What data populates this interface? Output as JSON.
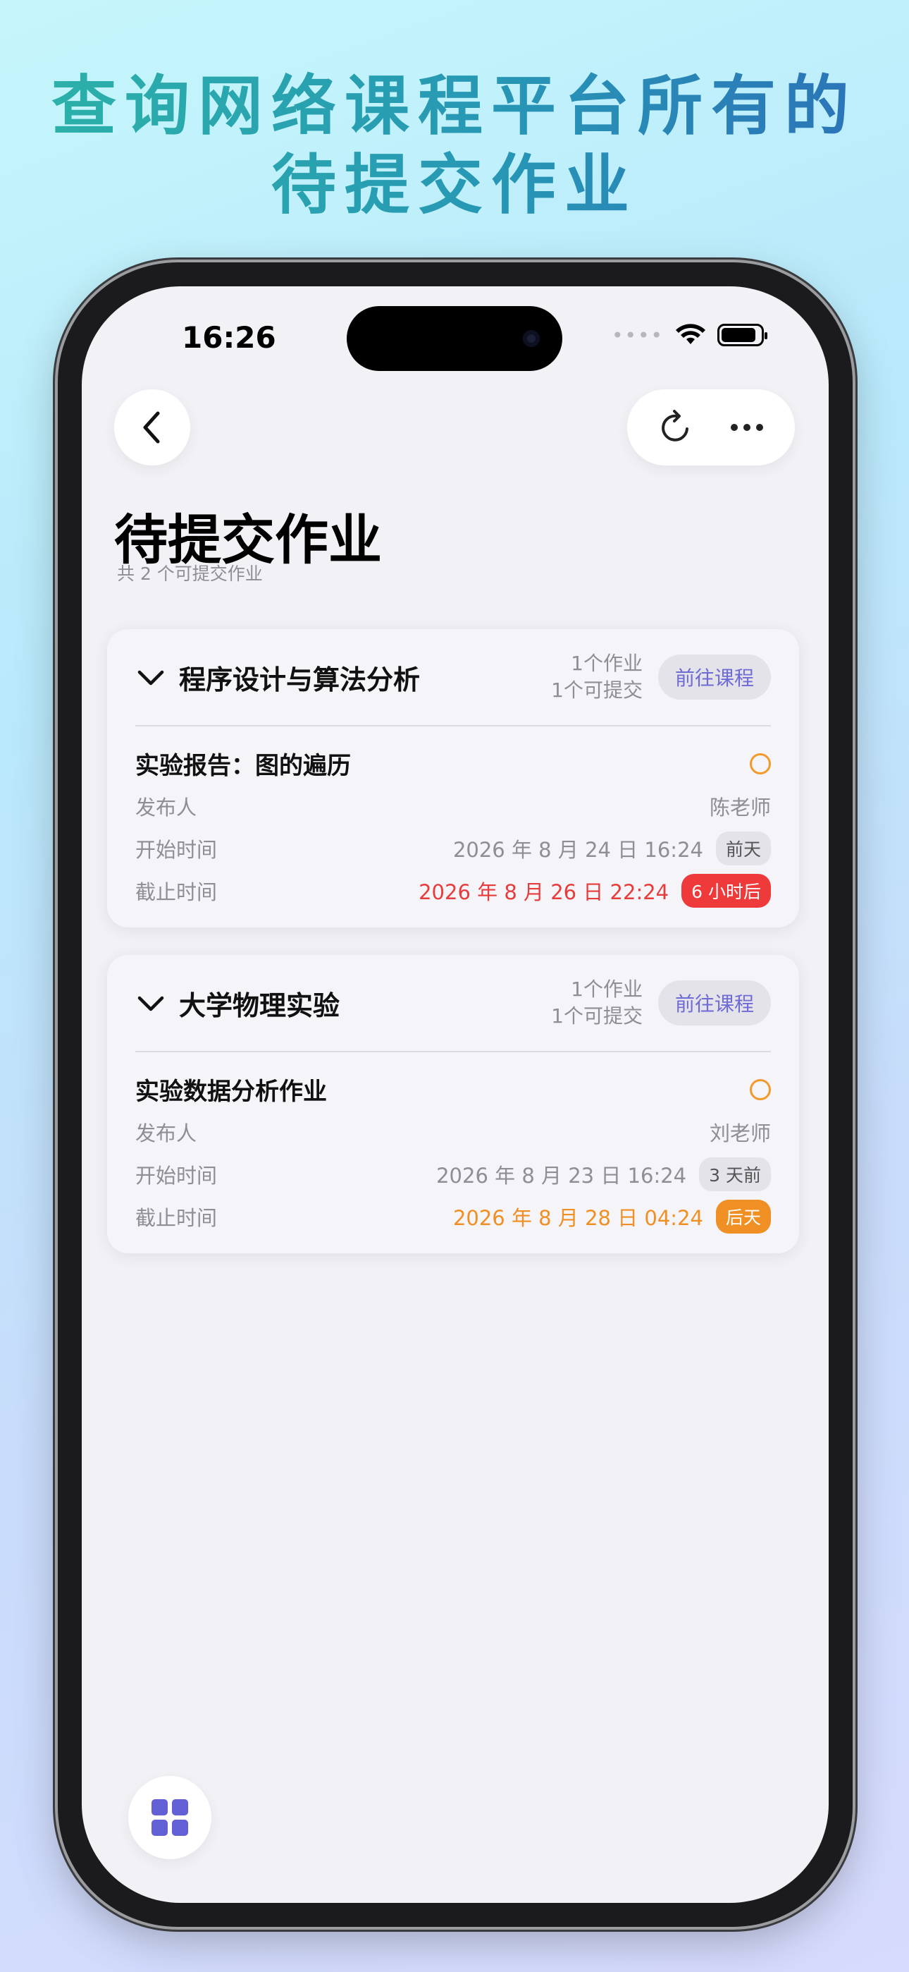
{
  "headline": {
    "line1": "查询网络课程平台所有的",
    "line2": "待提交作业"
  },
  "status": {
    "time": "16:26"
  },
  "page": {
    "title": "待提交作业",
    "subtitle": "共 2 个可提交作业"
  },
  "courses": [
    {
      "title": "程序设计与算法分析",
      "count_assignments": "1个作业",
      "count_submittable": "1个可提交",
      "goto_label": "前往课程",
      "assignment": {
        "title": "实验报告：图的遍历",
        "publisher_label": "发布人",
        "publisher": "陈老师",
        "start_label": "开始时间",
        "start": "2026 年 8 月 24 日 16:24",
        "start_tag": "前天",
        "due_label": "截止时间",
        "due": "2026 年 8 月 26 日 22:24",
        "due_tag": "6 小时后"
      }
    },
    {
      "title": "大学物理实验",
      "count_assignments": "1个作业",
      "count_submittable": "1个可提交",
      "goto_label": "前往课程",
      "assignment": {
        "title": "实验数据分析作业",
        "publisher_label": "发布人",
        "publisher": "刘老师",
        "start_label": "开始时间",
        "start": "2026 年 8 月 23 日 16:24",
        "start_tag": "3 天前",
        "due_label": "截止时间",
        "due": "2026 年 8 月 28 日 04:24",
        "due_tag": "后天"
      }
    }
  ],
  "colors": {
    "accent": "#6f6bd6",
    "danger": "#e73c3c",
    "warning": "#f08f24",
    "headline_start": "#2cb3a8",
    "headline_end": "#2c6fb8"
  },
  "icons": [
    "back-chevron-icon",
    "refresh-icon",
    "more-icon",
    "chevron-down-icon",
    "status-ring-icon",
    "grid-icon",
    "wifi-icon",
    "battery-icon",
    "signal-dots-icon"
  ]
}
